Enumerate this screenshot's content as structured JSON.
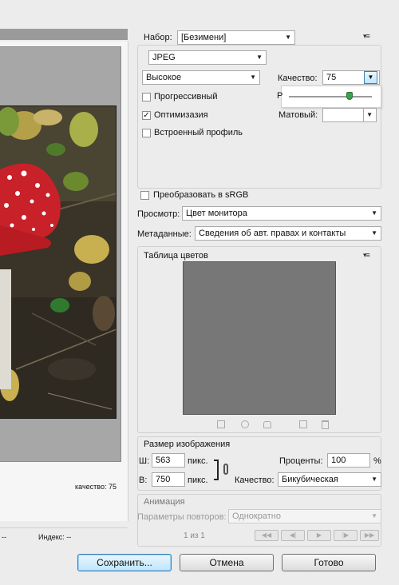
{
  "preset": {
    "label": "Набор:",
    "value": "[Безимени]"
  },
  "format": {
    "value": "JPEG"
  },
  "quality_preset": {
    "value": "Высокое"
  },
  "quality": {
    "label": "Качество:",
    "value": "75",
    "slider_letter": "Р"
  },
  "options": {
    "progressive": "Прогрессивный",
    "optimized": "Оптимизазия",
    "embed_profile": "Встроенный профиль",
    "convert_srgb": "Преобразовать в sRGB"
  },
  "matte": {
    "label": "Матовый:"
  },
  "preview": {
    "label": "Просмотр:",
    "value": "Цвет монитора"
  },
  "metadata": {
    "label": "Метаданные:",
    "value": "Сведения об авт. правах и контакты"
  },
  "color_table": {
    "title": "Таблица цветов"
  },
  "image_size": {
    "title": "Размер изображения",
    "width_label": "Ш:",
    "width_value": "563",
    "height_label": "В:",
    "height_value": "750",
    "unit": "пикс.",
    "percent_label": "Проценты:",
    "percent_value": "100",
    "percent_sign": "%",
    "quality_label": "Качество:",
    "quality_value": "Бикубическая"
  },
  "animation": {
    "title": "Анимация",
    "loop_label": "Параметры повторов:",
    "loop_value": "Однократно",
    "counter": "1 из 1"
  },
  "preview_pane": {
    "quality_text": "качество: 75",
    "status_left": "--",
    "index_label": "Индекс: --",
    "status_right": "--"
  },
  "buttons": {
    "save": "Сохранить...",
    "cancel": "Отмена",
    "done": "Готово"
  }
}
